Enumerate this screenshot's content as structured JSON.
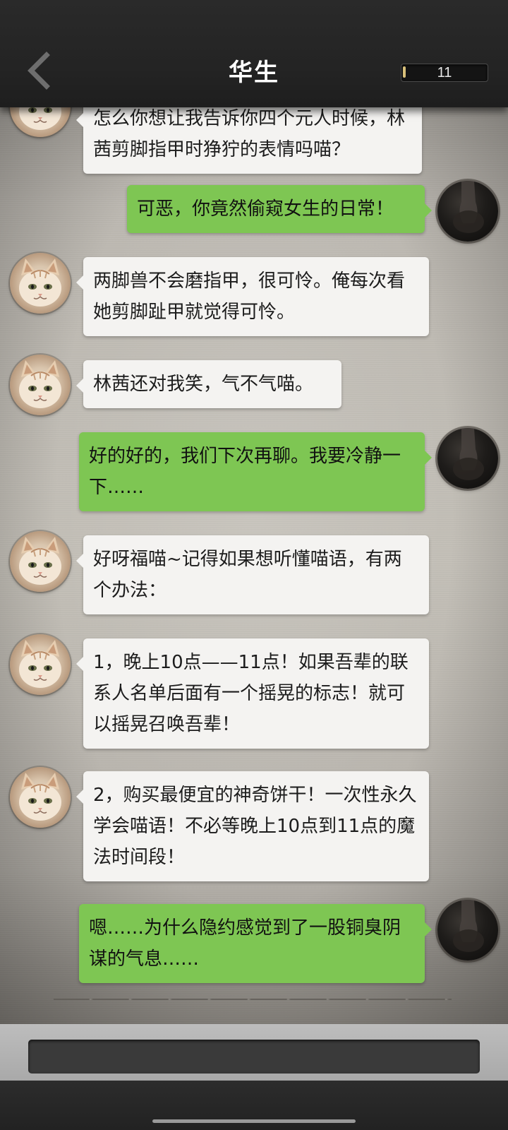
{
  "header": {
    "title": "华生",
    "counter_value": "11",
    "counter_fill_fraction": 0.03
  },
  "messages": [
    {
      "side": "left",
      "sender": "cat",
      "text": "怎么你想让我告诉你四个元人时候，林茜剪脚指甲时狰狞的表情吗喵？"
    },
    {
      "side": "right",
      "sender": "user",
      "text": "可恶，你竟然偷窥女生的日常！"
    },
    {
      "side": "left",
      "sender": "cat",
      "text": "两脚兽不会磨指甲，很可怜。俺每次看她剪脚趾甲就觉得可怜。"
    },
    {
      "side": "left",
      "sender": "cat",
      "text": "林茜还对我笑，气不气喵。"
    },
    {
      "side": "right",
      "sender": "user",
      "text": "好的好的，我们下次再聊。我要冷静一下……"
    },
    {
      "side": "left",
      "sender": "cat",
      "text": "好呀福喵~记得如果想听懂喵语，有两个办法："
    },
    {
      "side": "left",
      "sender": "cat",
      "text": "1，晚上10点——11点！如果吾辈的联系人名单后面有一个摇晃的标志！就可以摇晃召唤吾辈！"
    },
    {
      "side": "left",
      "sender": "cat",
      "text": "2，购买最便宜的神奇饼干！一次性永久学会喵语！不必等晚上10点到11点的魔法时间段！"
    },
    {
      "side": "right",
      "sender": "user",
      "text": "嗯……为什么隐约感觉到了一股铜臭阴谋的气息……"
    }
  ],
  "input": {
    "value": "",
    "placeholder": ""
  },
  "icons": {
    "back": "chevron-left-icon",
    "cat_avatar": "cat-avatar",
    "user_avatar": "user-avatar"
  },
  "colors": {
    "header_bg": "#242424",
    "bubble_green": "#7ec653",
    "bubble_white": "#f4f3f1",
    "counter_fill": "#d8c07a"
  }
}
